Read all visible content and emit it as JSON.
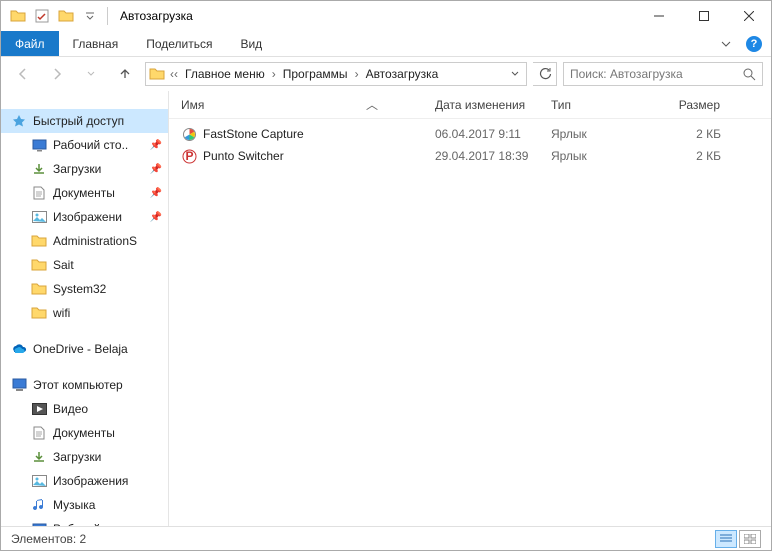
{
  "window": {
    "title": "Автозагрузка"
  },
  "ribbon": {
    "file": "Файл",
    "tabs": [
      "Главная",
      "Поделиться",
      "Вид"
    ]
  },
  "breadcrumbs": [
    "Главное меню",
    "Программы",
    "Автозагрузка"
  ],
  "search": {
    "placeholder": "Поиск: Автозагрузка"
  },
  "columns": {
    "name": "Имя",
    "date": "Дата изменения",
    "type": "Тип",
    "size": "Размер"
  },
  "files": [
    {
      "name": "FastStone Capture",
      "date": "06.04.2017 9:11",
      "type": "Ярлык",
      "size": "2 КБ",
      "icon": "faststone"
    },
    {
      "name": "Punto Switcher",
      "date": "29.04.2017 18:39",
      "type": "Ярлык",
      "size": "2 КБ",
      "icon": "punto"
    }
  ],
  "sidebar": {
    "quick": "Быстрый доступ",
    "quick_items": [
      {
        "label": "Рабочий сто..",
        "icon": "desktop",
        "pinned": true
      },
      {
        "label": "Загрузки",
        "icon": "downloads",
        "pinned": true
      },
      {
        "label": "Документы",
        "icon": "documents",
        "pinned": true
      },
      {
        "label": "Изображени",
        "icon": "pictures",
        "pinned": true
      },
      {
        "label": "AdministrationS",
        "icon": "folder",
        "pinned": false
      },
      {
        "label": "Sait",
        "icon": "folder",
        "pinned": false
      },
      {
        "label": "System32",
        "icon": "folder",
        "pinned": false
      },
      {
        "label": "wifi",
        "icon": "folder",
        "pinned": false
      }
    ],
    "onedrive": "OneDrive - Belaja",
    "thispc": "Этот компьютер",
    "pc_items": [
      {
        "label": "Видео",
        "icon": "videos"
      },
      {
        "label": "Документы",
        "icon": "documents"
      },
      {
        "label": "Загрузки",
        "icon": "downloads"
      },
      {
        "label": "Изображения",
        "icon": "pictures"
      },
      {
        "label": "Музыка",
        "icon": "music"
      },
      {
        "label": "Рабочий стол",
        "icon": "desktop"
      }
    ]
  },
  "status": {
    "count_label": "Элементов: 2"
  }
}
